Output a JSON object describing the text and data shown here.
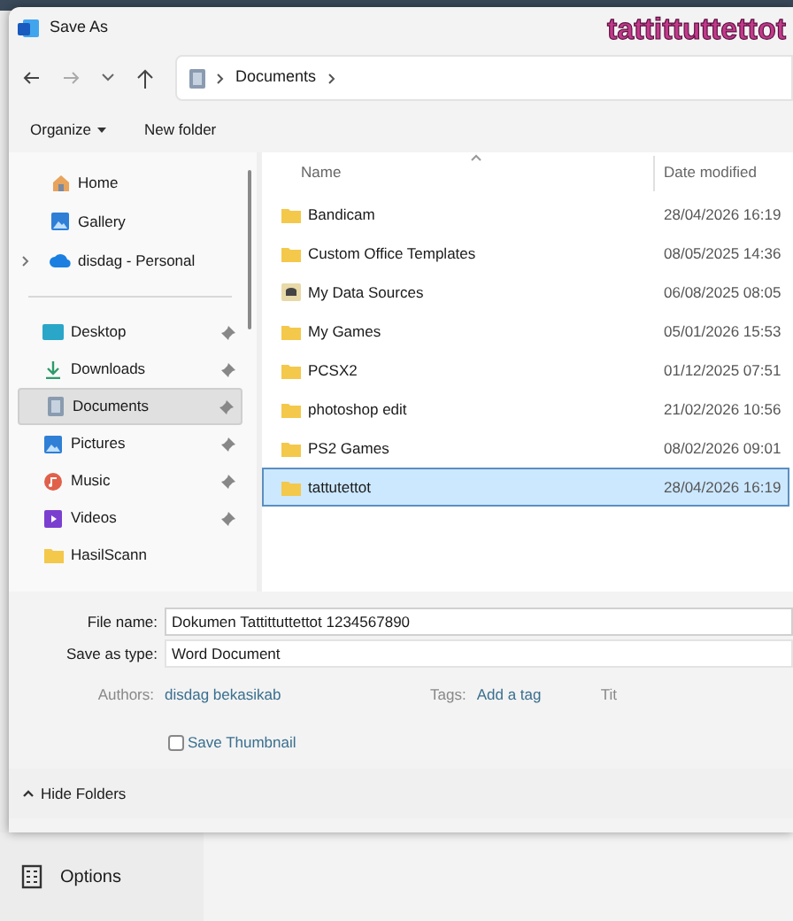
{
  "window": {
    "title": "Save As"
  },
  "overlay_caption": "tattittuttettot",
  "breadcrumb": [
    "Documents"
  ],
  "toolbar": [
    "Organize",
    "New folder"
  ],
  "sidebar": {
    "top": [
      {
        "label": "Home",
        "expandable": false
      },
      {
        "label": "Gallery",
        "expandable": false
      },
      {
        "label": "disdag - Personal",
        "expandable": true
      }
    ],
    "quick": [
      {
        "label": "Desktop",
        "pinned": true,
        "selected": false
      },
      {
        "label": "Downloads",
        "pinned": true,
        "selected": false
      },
      {
        "label": "Documents",
        "pinned": true,
        "selected": true
      },
      {
        "label": "Pictures",
        "pinned": true,
        "selected": false
      },
      {
        "label": "Music",
        "pinned": true,
        "selected": false
      },
      {
        "label": "Videos",
        "pinned": true,
        "selected": false
      },
      {
        "label": "HasilScann",
        "pinned": false,
        "selected": false
      }
    ]
  },
  "table": {
    "columns": [
      "Name",
      "Date modified"
    ],
    "rows": [
      {
        "name": "Bandicam",
        "date": "28/04/2026 16:19",
        "kind": "folder",
        "selected": false
      },
      {
        "name": "Custom Office Templates",
        "date": "08/05/2025 14:36",
        "kind": "folder",
        "selected": false
      },
      {
        "name": "My Data Sources",
        "date": "06/08/2025 08:05",
        "kind": "datasource",
        "selected": false
      },
      {
        "name": "My Games",
        "date": "05/01/2026 15:53",
        "kind": "folder",
        "selected": false
      },
      {
        "name": "PCSX2",
        "date": "01/12/2025 07:51",
        "kind": "folder",
        "selected": false
      },
      {
        "name": "photoshop edit",
        "date": "21/02/2026 10:56",
        "kind": "folder",
        "selected": false
      },
      {
        "name": "PS2 Games",
        "date": "08/02/2026 09:01",
        "kind": "folder",
        "selected": false
      },
      {
        "name": "tattutettot",
        "date": "28/04/2026 16:19",
        "kind": "folder",
        "selected": true
      }
    ]
  },
  "file_name": {
    "label": "File name:",
    "value": "Dokumen Tattittuttettot 1234567890"
  },
  "save_as_type": {
    "label": "Save as type:",
    "value": "Word Document"
  },
  "properties": [
    {
      "label": "Authors:",
      "value": "disdag bekasikab"
    },
    {
      "label": "Tags:",
      "value": "Add a tag"
    },
    {
      "label": "Tit"
    }
  ],
  "save_thumbnail": {
    "label": "Save Thumbnail",
    "checked": false
  },
  "hide_folders": "Hide Folders",
  "background": {
    "options": "Options"
  }
}
